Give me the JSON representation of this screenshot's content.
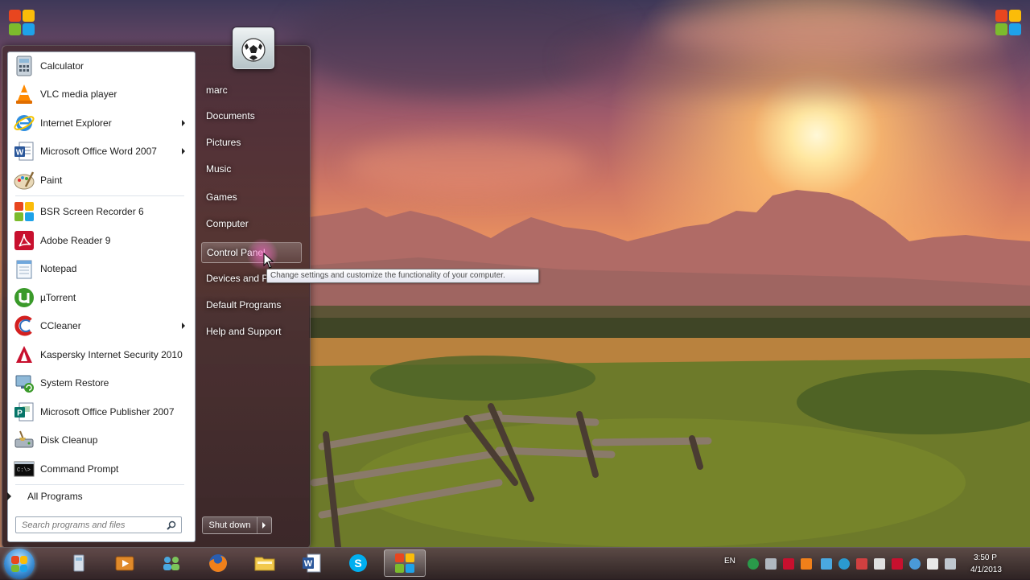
{
  "start_menu": {
    "programs": [
      {
        "label": "Calculator",
        "icon": "calculator-icon",
        "submenu": false
      },
      {
        "label": "VLC media player",
        "icon": "vlc-icon",
        "submenu": false
      },
      {
        "label": "Internet Explorer",
        "icon": "internet-explorer-icon",
        "submenu": true
      },
      {
        "label": "Microsoft Office Word 2007",
        "icon": "word-icon",
        "submenu": true
      },
      {
        "label": "Paint",
        "icon": "paint-icon",
        "submenu": false
      },
      {
        "label": "BSR Screen Recorder 6",
        "icon": "bsr-recorder-icon",
        "submenu": false
      },
      {
        "label": "Adobe Reader 9",
        "icon": "adobe-reader-icon",
        "submenu": false
      },
      {
        "label": "Notepad",
        "icon": "notepad-icon",
        "submenu": false
      },
      {
        "label": "µTorrent",
        "icon": "utorrent-icon",
        "submenu": false
      },
      {
        "label": "CCleaner",
        "icon": "ccleaner-icon",
        "submenu": true
      },
      {
        "label": "Kaspersky Internet Security 2010",
        "icon": "kaspersky-icon",
        "submenu": false
      },
      {
        "label": "System Restore",
        "icon": "system-restore-icon",
        "submenu": false
      },
      {
        "label": "Microsoft Office Publisher 2007",
        "icon": "publisher-icon",
        "submenu": false
      },
      {
        "label": "Disk Cleanup",
        "icon": "disk-cleanup-icon",
        "submenu": false
      },
      {
        "label": "Command Prompt",
        "icon": "command-prompt-icon",
        "submenu": false
      }
    ],
    "all_programs": "All Programs",
    "search_placeholder": "Search programs and files",
    "right_items": [
      {
        "label": "marc"
      },
      {
        "label": "Documents"
      },
      {
        "label": "Pictures"
      },
      {
        "label": "Music"
      },
      {
        "label": "Games"
      },
      {
        "label": "Computer"
      },
      {
        "label": "Control Panel"
      },
      {
        "label": "Devices and Pr"
      },
      {
        "label": "Default Programs"
      },
      {
        "label": "Help and Support"
      }
    ],
    "hovered_item": "Control Panel",
    "shutdown_label": "Shut down",
    "tooltip": "Change settings and customize the functionality of your computer."
  },
  "taskbar": {
    "pinned": [
      "explorer-icon",
      "media-player-icon",
      "network-people-icon",
      "firefox-icon",
      "folder-icon",
      "word-icon",
      "skype-icon",
      "bsr-recorder-icon"
    ],
    "active_button": "bsr-recorder-icon",
    "tray": {
      "language": "EN",
      "time": "3:50 P",
      "date": "4/1/2013"
    }
  },
  "colors": {
    "menu_frame": "#3a262c",
    "tooltip_border": "#767676",
    "accent": "#1ea2e8"
  }
}
